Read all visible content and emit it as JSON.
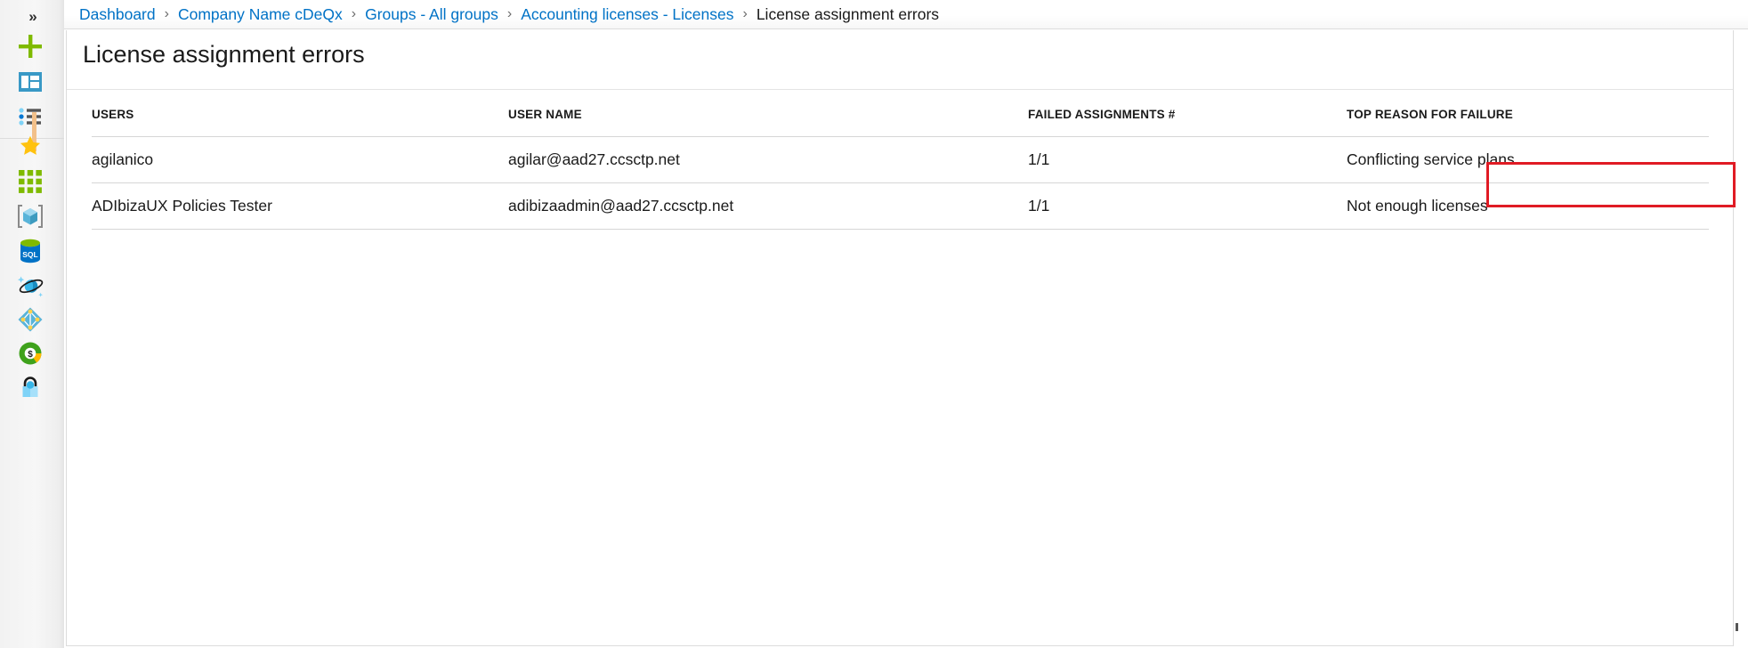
{
  "rail": {
    "collapse_label": "»",
    "items": [
      {
        "name": "create-resource",
        "icon": "plus-icon",
        "label": "Create a resource"
      },
      {
        "name": "dashboard",
        "icon": "dashboard-icon",
        "label": "Dashboard"
      },
      {
        "name": "all-services",
        "icon": "all-services-list-icon",
        "label": "All services"
      },
      {
        "name": "favorites",
        "icon": "star-icon",
        "label": "Favorites"
      },
      {
        "name": "all-resources",
        "icon": "grid-icon",
        "label": "All resources"
      },
      {
        "name": "resource-groups",
        "icon": "cube-brackets-icon",
        "label": "Resource groups"
      },
      {
        "name": "sql-databases",
        "icon": "sql-database-icon",
        "label": "SQL databases"
      },
      {
        "name": "azure-cosmos-db",
        "icon": "cosmos-db-planet-icon",
        "label": "Azure Cosmos DB"
      },
      {
        "name": "virtual-machines",
        "icon": "vm-diamond-icon",
        "label": "Virtual machines"
      },
      {
        "name": "cost-management",
        "icon": "cost-donut-icon",
        "label": "Cost Management + Billing"
      },
      {
        "name": "security-center",
        "icon": "security-lock-icon",
        "label": "Security Center"
      }
    ]
  },
  "breadcrumb": {
    "items": [
      {
        "label": "Dashboard",
        "current": false
      },
      {
        "label": "Company Name cDeQx",
        "current": false
      },
      {
        "label": "Groups - All groups",
        "current": false
      },
      {
        "label": "Accounting licenses - Licenses",
        "current": false
      },
      {
        "label": "License assignment errors",
        "current": true
      }
    ],
    "separator": "›",
    "link_color": "#0072c6"
  },
  "blade": {
    "title": "License assignment errors"
  },
  "table": {
    "columns": [
      {
        "key": "users",
        "label": "USERS"
      },
      {
        "key": "username",
        "label": "USER NAME"
      },
      {
        "key": "failed",
        "label": "FAILED ASSIGNMENTS #"
      },
      {
        "key": "reason",
        "label": "TOP REASON FOR FAILURE"
      }
    ],
    "rows": [
      {
        "users": "agilanico",
        "username": "agilar@aad27.ccsctp.net",
        "failed": "1/1",
        "reason": "Conflicting service plans",
        "highlighted": true
      },
      {
        "users": "ADIbizaUX Policies Tester",
        "username": "adibizaadmin@aad27.ccsctp.net",
        "failed": "1/1",
        "reason": "Not enough licenses",
        "highlighted": false
      }
    ]
  },
  "annotation": {
    "highlight_color": "#e01b24",
    "highlight_target": "Conflicting service plans"
  }
}
